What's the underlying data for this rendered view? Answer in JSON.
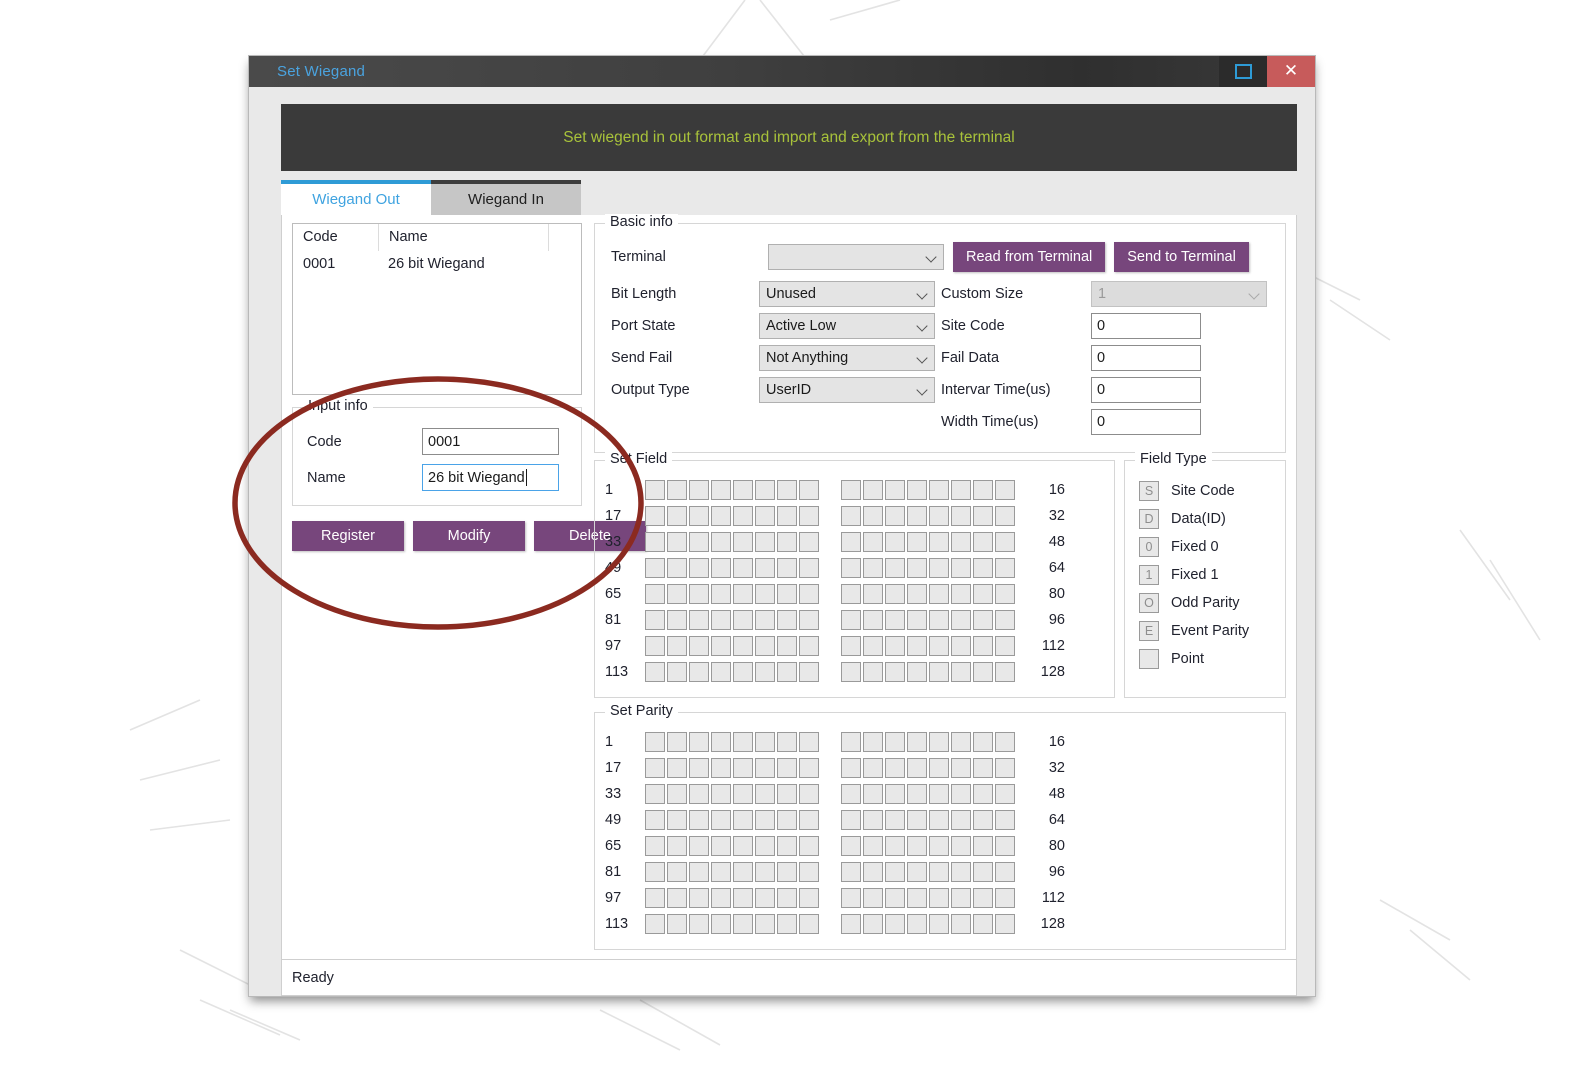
{
  "window": {
    "title": "Set Wiegand",
    "maximize_icon": "maximize-icon",
    "close_icon": "close-icon",
    "banner_text": "Set wiegend in  out format and import and export from the terminal",
    "status_text": "Ready"
  },
  "tabs": [
    {
      "label": "Wiegand Out",
      "active": true
    },
    {
      "label": "Wiegand In",
      "active": false
    }
  ],
  "list": {
    "headers": [
      "Code",
      "Name",
      ""
    ],
    "rows": [
      {
        "code": "0001",
        "name": "26 bit Wiegand"
      }
    ]
  },
  "input_info": {
    "legend": "Input info",
    "code_label": "Code",
    "code_value": "0001",
    "name_label": "Name",
    "name_value": "26 bit Wiegand",
    "name_focused": true,
    "buttons": [
      {
        "label": "Register"
      },
      {
        "label": "Modify"
      },
      {
        "label": "Delete"
      }
    ]
  },
  "basic_info": {
    "legend": "Basic info",
    "terminal_label": "Terminal",
    "terminal_value": "",
    "read_button": "Read from Terminal",
    "send_button": "Send to Terminal",
    "left_fields": [
      {
        "label": "Bit Length",
        "value": "Unused"
      },
      {
        "label": "Port State",
        "value": "Active Low"
      },
      {
        "label": "Send Fail",
        "value": "Not Anything"
      },
      {
        "label": "Output Type",
        "value": "UserID"
      }
    ],
    "right_fields": [
      {
        "label": "Custom Size",
        "value": "1",
        "type": "combo",
        "disabled": true
      },
      {
        "label": "Site Code",
        "value": "0",
        "type": "text"
      },
      {
        "label": "Fail Data",
        "value": "0",
        "type": "text"
      },
      {
        "label": "Intervar Time(us)",
        "value": "0",
        "type": "text"
      },
      {
        "label": "Width Time(us)",
        "value": "0",
        "type": "text"
      }
    ]
  },
  "set_field": {
    "legend": "Set Field",
    "left_labels": [
      "1",
      "17",
      "33",
      "49",
      "65",
      "81",
      "97",
      "113"
    ],
    "right_labels": [
      "16",
      "32",
      "48",
      "64",
      "80",
      "96",
      "112",
      "128"
    ],
    "cells_per_group": 8,
    "groups_per_row": 2,
    "rows": 8
  },
  "set_parity": {
    "legend": "Set Parity",
    "left_labels": [
      "1",
      "17",
      "33",
      "49",
      "65",
      "81",
      "97",
      "113"
    ],
    "right_labels": [
      "16",
      "32",
      "48",
      "64",
      "80",
      "96",
      "112",
      "128"
    ],
    "cells_per_group": 8,
    "groups_per_row": 2,
    "rows": 8
  },
  "field_type": {
    "legend": "Field Type",
    "items": [
      {
        "glyph": "S",
        "label": "Site Code"
      },
      {
        "glyph": "D",
        "label": "Data(ID)"
      },
      {
        "glyph": "0",
        "label": "Fixed 0"
      },
      {
        "glyph": "1",
        "label": "Fixed 1"
      },
      {
        "glyph": "O",
        "label": "Odd Parity"
      },
      {
        "glyph": "E",
        "label": "Event Parity"
      },
      {
        "glyph": "",
        "label": "Point"
      }
    ]
  },
  "annotation": {
    "shape": "ellipse-highlight",
    "color": "#8b2a20"
  },
  "colors": {
    "accent_purple": "#77467c",
    "tab_active_blue": "#3fa3e0",
    "banner_text": "#a8c23a",
    "title_text": "#4aa3df",
    "close_button": "#c75b5b",
    "annotation": "#8b2a20"
  }
}
